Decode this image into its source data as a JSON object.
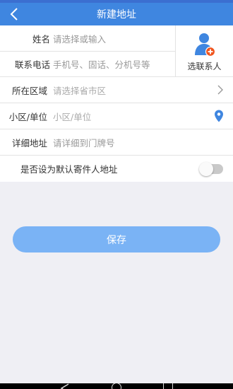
{
  "header": {
    "title": "新建地址",
    "back_icon": "chevron-left-icon"
  },
  "form": {
    "name": {
      "label": "姓名",
      "placeholder": "请选择或输入"
    },
    "phone": {
      "label": "联系电话",
      "placeholder": "手机号、固话、分机号等"
    },
    "pick_contact": {
      "label": "选联系人",
      "icon": "add-contact-icon"
    },
    "region": {
      "label": "所在区域",
      "placeholder": "请选择省市区",
      "icon": "chevron-right-icon"
    },
    "community": {
      "label": "小区/单位",
      "placeholder": "小区/单位",
      "icon": "location-pin-icon"
    },
    "detail": {
      "label": "详细地址",
      "placeholder": "请详细到门牌号"
    },
    "default_sender": {
      "label": "是否设为默认寄件人地址",
      "enabled": false
    }
  },
  "actions": {
    "save_label": "保存"
  },
  "colors": {
    "header": "#3f86e0",
    "accent": "#3f86e0",
    "save_button": "#7ab3f5",
    "background": "#efeff4",
    "location_pin": "#3f86e0",
    "badge": "#f0531c"
  },
  "nav": {
    "icons": [
      "back-triangle-icon",
      "home-circle-icon",
      "recent-square-icon"
    ]
  }
}
